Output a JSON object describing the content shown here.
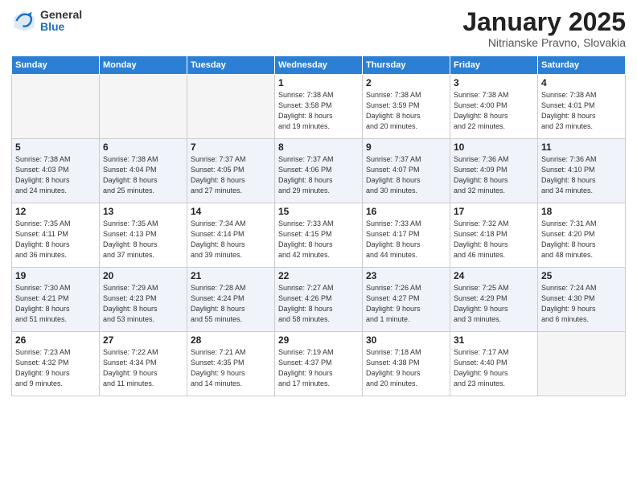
{
  "header": {
    "logo_general": "General",
    "logo_blue": "Blue",
    "title": "January 2025",
    "subtitle": "Nitrianske Pravno, Slovakia"
  },
  "days_header": [
    "Sunday",
    "Monday",
    "Tuesday",
    "Wednesday",
    "Thursday",
    "Friday",
    "Saturday"
  ],
  "weeks": [
    {
      "shade": false,
      "days": [
        {
          "num": "",
          "info": "",
          "empty": true
        },
        {
          "num": "",
          "info": "",
          "empty": true
        },
        {
          "num": "",
          "info": "",
          "empty": true
        },
        {
          "num": "1",
          "info": "Sunrise: 7:38 AM\nSunset: 3:58 PM\nDaylight: 8 hours\nand 19 minutes.",
          "empty": false
        },
        {
          "num": "2",
          "info": "Sunrise: 7:38 AM\nSunset: 3:59 PM\nDaylight: 8 hours\nand 20 minutes.",
          "empty": false
        },
        {
          "num": "3",
          "info": "Sunrise: 7:38 AM\nSunset: 4:00 PM\nDaylight: 8 hours\nand 22 minutes.",
          "empty": false
        },
        {
          "num": "4",
          "info": "Sunrise: 7:38 AM\nSunset: 4:01 PM\nDaylight: 8 hours\nand 23 minutes.",
          "empty": false
        }
      ]
    },
    {
      "shade": true,
      "days": [
        {
          "num": "5",
          "info": "Sunrise: 7:38 AM\nSunset: 4:03 PM\nDaylight: 8 hours\nand 24 minutes.",
          "empty": false
        },
        {
          "num": "6",
          "info": "Sunrise: 7:38 AM\nSunset: 4:04 PM\nDaylight: 8 hours\nand 25 minutes.",
          "empty": false
        },
        {
          "num": "7",
          "info": "Sunrise: 7:37 AM\nSunset: 4:05 PM\nDaylight: 8 hours\nand 27 minutes.",
          "empty": false
        },
        {
          "num": "8",
          "info": "Sunrise: 7:37 AM\nSunset: 4:06 PM\nDaylight: 8 hours\nand 29 minutes.",
          "empty": false
        },
        {
          "num": "9",
          "info": "Sunrise: 7:37 AM\nSunset: 4:07 PM\nDaylight: 8 hours\nand 30 minutes.",
          "empty": false
        },
        {
          "num": "10",
          "info": "Sunrise: 7:36 AM\nSunset: 4:09 PM\nDaylight: 8 hours\nand 32 minutes.",
          "empty": false
        },
        {
          "num": "11",
          "info": "Sunrise: 7:36 AM\nSunset: 4:10 PM\nDaylight: 8 hours\nand 34 minutes.",
          "empty": false
        }
      ]
    },
    {
      "shade": false,
      "days": [
        {
          "num": "12",
          "info": "Sunrise: 7:35 AM\nSunset: 4:11 PM\nDaylight: 8 hours\nand 36 minutes.",
          "empty": false
        },
        {
          "num": "13",
          "info": "Sunrise: 7:35 AM\nSunset: 4:13 PM\nDaylight: 8 hours\nand 37 minutes.",
          "empty": false
        },
        {
          "num": "14",
          "info": "Sunrise: 7:34 AM\nSunset: 4:14 PM\nDaylight: 8 hours\nand 39 minutes.",
          "empty": false
        },
        {
          "num": "15",
          "info": "Sunrise: 7:33 AM\nSunset: 4:15 PM\nDaylight: 8 hours\nand 42 minutes.",
          "empty": false
        },
        {
          "num": "16",
          "info": "Sunrise: 7:33 AM\nSunset: 4:17 PM\nDaylight: 8 hours\nand 44 minutes.",
          "empty": false
        },
        {
          "num": "17",
          "info": "Sunrise: 7:32 AM\nSunset: 4:18 PM\nDaylight: 8 hours\nand 46 minutes.",
          "empty": false
        },
        {
          "num": "18",
          "info": "Sunrise: 7:31 AM\nSunset: 4:20 PM\nDaylight: 8 hours\nand 48 minutes.",
          "empty": false
        }
      ]
    },
    {
      "shade": true,
      "days": [
        {
          "num": "19",
          "info": "Sunrise: 7:30 AM\nSunset: 4:21 PM\nDaylight: 8 hours\nand 51 minutes.",
          "empty": false
        },
        {
          "num": "20",
          "info": "Sunrise: 7:29 AM\nSunset: 4:23 PM\nDaylight: 8 hours\nand 53 minutes.",
          "empty": false
        },
        {
          "num": "21",
          "info": "Sunrise: 7:28 AM\nSunset: 4:24 PM\nDaylight: 8 hours\nand 55 minutes.",
          "empty": false
        },
        {
          "num": "22",
          "info": "Sunrise: 7:27 AM\nSunset: 4:26 PM\nDaylight: 8 hours\nand 58 minutes.",
          "empty": false
        },
        {
          "num": "23",
          "info": "Sunrise: 7:26 AM\nSunset: 4:27 PM\nDaylight: 9 hours\nand 1 minute.",
          "empty": false
        },
        {
          "num": "24",
          "info": "Sunrise: 7:25 AM\nSunset: 4:29 PM\nDaylight: 9 hours\nand 3 minutes.",
          "empty": false
        },
        {
          "num": "25",
          "info": "Sunrise: 7:24 AM\nSunset: 4:30 PM\nDaylight: 9 hours\nand 6 minutes.",
          "empty": false
        }
      ]
    },
    {
      "shade": false,
      "days": [
        {
          "num": "26",
          "info": "Sunrise: 7:23 AM\nSunset: 4:32 PM\nDaylight: 9 hours\nand 9 minutes.",
          "empty": false
        },
        {
          "num": "27",
          "info": "Sunrise: 7:22 AM\nSunset: 4:34 PM\nDaylight: 9 hours\nand 11 minutes.",
          "empty": false
        },
        {
          "num": "28",
          "info": "Sunrise: 7:21 AM\nSunset: 4:35 PM\nDaylight: 9 hours\nand 14 minutes.",
          "empty": false
        },
        {
          "num": "29",
          "info": "Sunrise: 7:19 AM\nSunset: 4:37 PM\nDaylight: 9 hours\nand 17 minutes.",
          "empty": false
        },
        {
          "num": "30",
          "info": "Sunrise: 7:18 AM\nSunset: 4:38 PM\nDaylight: 9 hours\nand 20 minutes.",
          "empty": false
        },
        {
          "num": "31",
          "info": "Sunrise: 7:17 AM\nSunset: 4:40 PM\nDaylight: 9 hours\nand 23 minutes.",
          "empty": false
        },
        {
          "num": "",
          "info": "",
          "empty": true
        }
      ]
    }
  ]
}
